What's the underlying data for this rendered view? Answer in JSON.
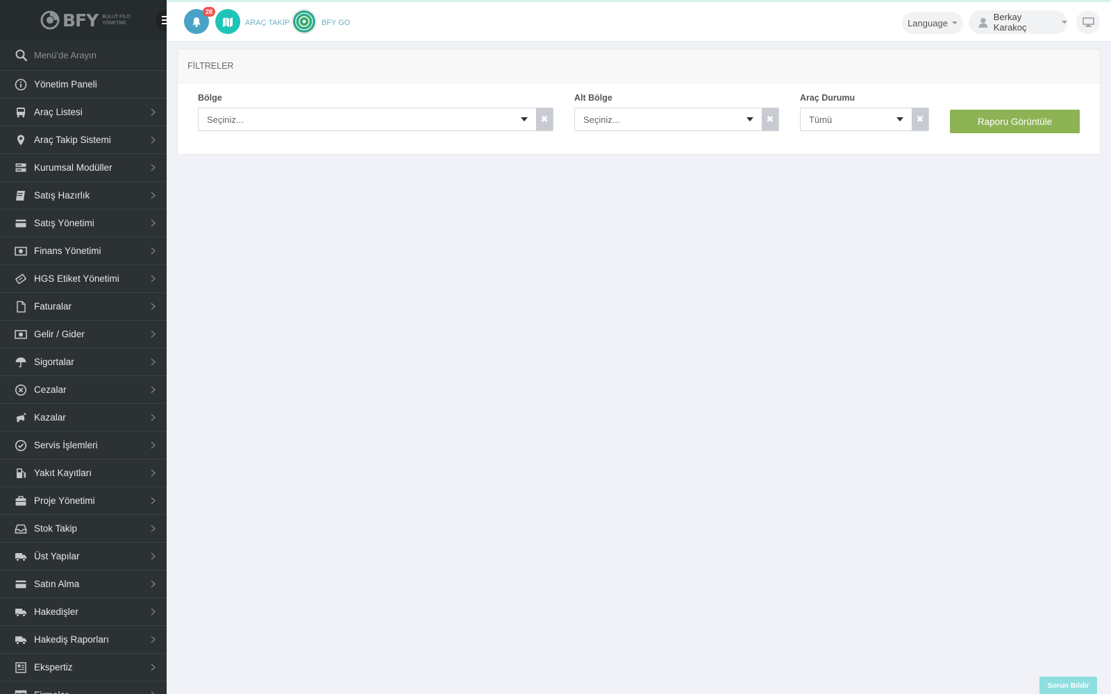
{
  "brand": {
    "logo_text": "BFY",
    "logo_sub": "BULUT FİLO YÖNETİMİ"
  },
  "sidebar": {
    "search_placeholder": "Menü'de Arayın",
    "items": [
      {
        "label": "Yönetim Paneli",
        "icon": "info-circle-icon",
        "chevron": false
      },
      {
        "label": "Araç Listesi",
        "icon": "bus-icon",
        "chevron": true
      },
      {
        "label": "Araç Takip Sistemi",
        "icon": "map-pin-icon",
        "chevron": true
      },
      {
        "label": "Kurumsal Modüller",
        "icon": "server-icon",
        "chevron": true
      },
      {
        "label": "Satış Hazırlık",
        "icon": "book-icon",
        "chevron": true
      },
      {
        "label": "Satış Yönetimi",
        "icon": "credit-card-icon",
        "chevron": true
      },
      {
        "label": "Finans Yönetimi",
        "icon": "money-icon",
        "chevron": true
      },
      {
        "label": "HGS Etiket Yönetimi",
        "icon": "ticket-icon",
        "chevron": true
      },
      {
        "label": "Faturalar",
        "icon": "file-icon",
        "chevron": true
      },
      {
        "label": "Gelir / Gider",
        "icon": "money-icon",
        "chevron": true
      },
      {
        "label": "Sigortalar",
        "icon": "umbrella-icon",
        "chevron": true
      },
      {
        "label": "Cezalar",
        "icon": "times-circle-icon",
        "chevron": true
      },
      {
        "label": "Kazalar",
        "icon": "car-crash-icon",
        "chevron": true
      },
      {
        "label": "Servis İşlemleri",
        "icon": "check-circle-icon",
        "chevron": true
      },
      {
        "label": "Yakıt Kayıtları",
        "icon": "gas-pump-icon",
        "chevron": true
      },
      {
        "label": "Proje Yönetimi",
        "icon": "briefcase-icon",
        "chevron": true
      },
      {
        "label": "Stok Takip",
        "icon": "inbox-icon",
        "chevron": true
      },
      {
        "label": "Üst Yapılar",
        "icon": "truck-icon",
        "chevron": true
      },
      {
        "label": "Satın Alma",
        "icon": "credit-card-icon",
        "chevron": true
      },
      {
        "label": "Hakedişler",
        "icon": "truck-icon",
        "chevron": true
      },
      {
        "label": "Hakediş Raporları",
        "icon": "truck-icon",
        "chevron": true
      },
      {
        "label": "Ekspertiz",
        "icon": "newspaper-icon",
        "chevron": true
      },
      {
        "label": "Firmalar",
        "icon": "table-icon",
        "chevron": true
      }
    ]
  },
  "topbar": {
    "notification_count": "28",
    "arac_takip_label": "ARAÇ TAKİP",
    "bfy_go_label": "BFY GO",
    "language_label": "Language",
    "user_name": "Berkay Karakoç"
  },
  "filters": {
    "title": "FİLTRELER",
    "bolge": {
      "label": "Bölge",
      "value": "Seçiniz..."
    },
    "alt_bolge": {
      "label": "Alt Bölge",
      "value": "Seçiniz..."
    },
    "arac_durumu": {
      "label": "Araç Durumu",
      "value": "Tümü"
    },
    "submit_label": "Raporu Görüntüle",
    "clear_symbol": "✖"
  },
  "report_issue_label": "Sorun Bildir",
  "colors": {
    "sidebar_bg": "#2c3134",
    "accent_green": "#8db354",
    "bell_blue": "#49a3c7",
    "map_teal": "#1ec4b8",
    "badge_red": "#ef5350"
  }
}
